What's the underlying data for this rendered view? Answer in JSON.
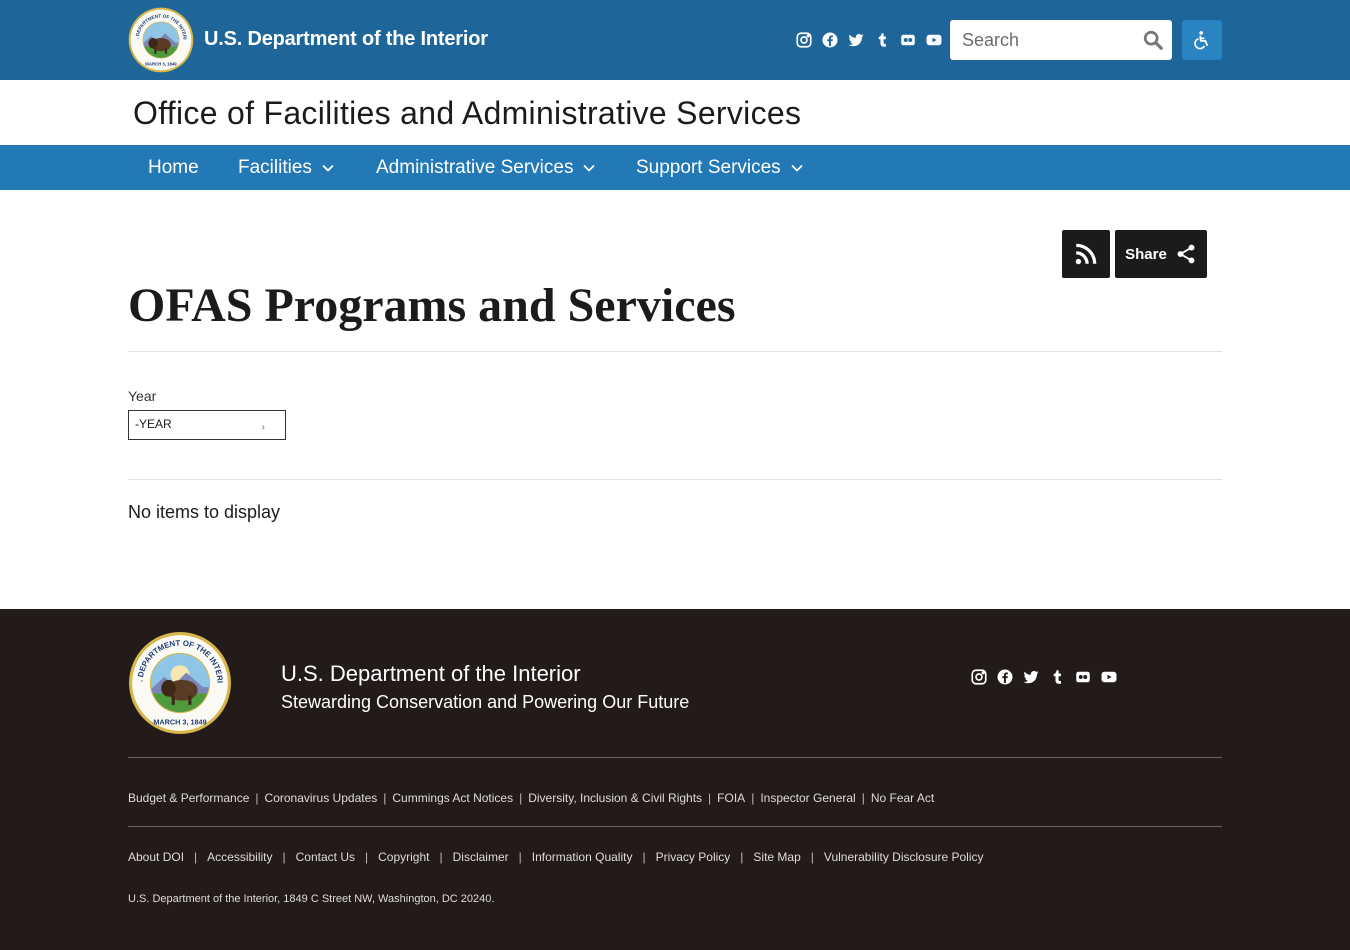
{
  "header": {
    "brand": "U.S. Department of the Interior",
    "seal_text_top": "U.S. DEPARTMENT OF THE INTERIOR",
    "seal_text_bottom": "MARCH 3, 1849",
    "social_icons": [
      "instagram-icon",
      "facebook-icon",
      "twitter-icon",
      "tumblr-icon",
      "flickr-icon",
      "youtube-icon"
    ],
    "search": {
      "placeholder": "Search"
    },
    "colors": {
      "topbar": "#1e6599",
      "nav": "#2378b6",
      "a11y": "#2b84c2"
    }
  },
  "office": {
    "title": "Office of Facilities and Administrative Services"
  },
  "nav": {
    "items": [
      {
        "label": "Home",
        "has_dropdown": false
      },
      {
        "label": "Facilities",
        "has_dropdown": true
      },
      {
        "label": "Administrative Services",
        "has_dropdown": true
      },
      {
        "label": "Support Services",
        "has_dropdown": true
      }
    ]
  },
  "main": {
    "share_label": "Share",
    "page_title": "OFAS Programs and Services",
    "filter": {
      "label": "Year",
      "selected": "-YEAR"
    },
    "empty_message": "No items to display"
  },
  "footer": {
    "title": "U.S. Department of the Interior",
    "subtitle": "Stewarding Conservation and Powering Our Future",
    "links_row1": [
      "Budget & Performance",
      "Coronavirus Updates",
      "Cummings Act Notices",
      "Diversity, Inclusion & Civil Rights",
      "FOIA",
      "Inspector General",
      "No Fear Act"
    ],
    "links_row2": [
      "About DOI",
      "Accessibility",
      "Contact Us",
      "Copyright",
      "Disclaimer",
      "Information Quality",
      "Privacy Policy",
      "Site Map",
      "Vulnerability Disclosure Policy"
    ],
    "address": "U.S. Department of the Interior, 1849 C Street NW, Washington, DC 20240.",
    "separator": "|",
    "colors": {
      "background": "#231a1a"
    }
  }
}
